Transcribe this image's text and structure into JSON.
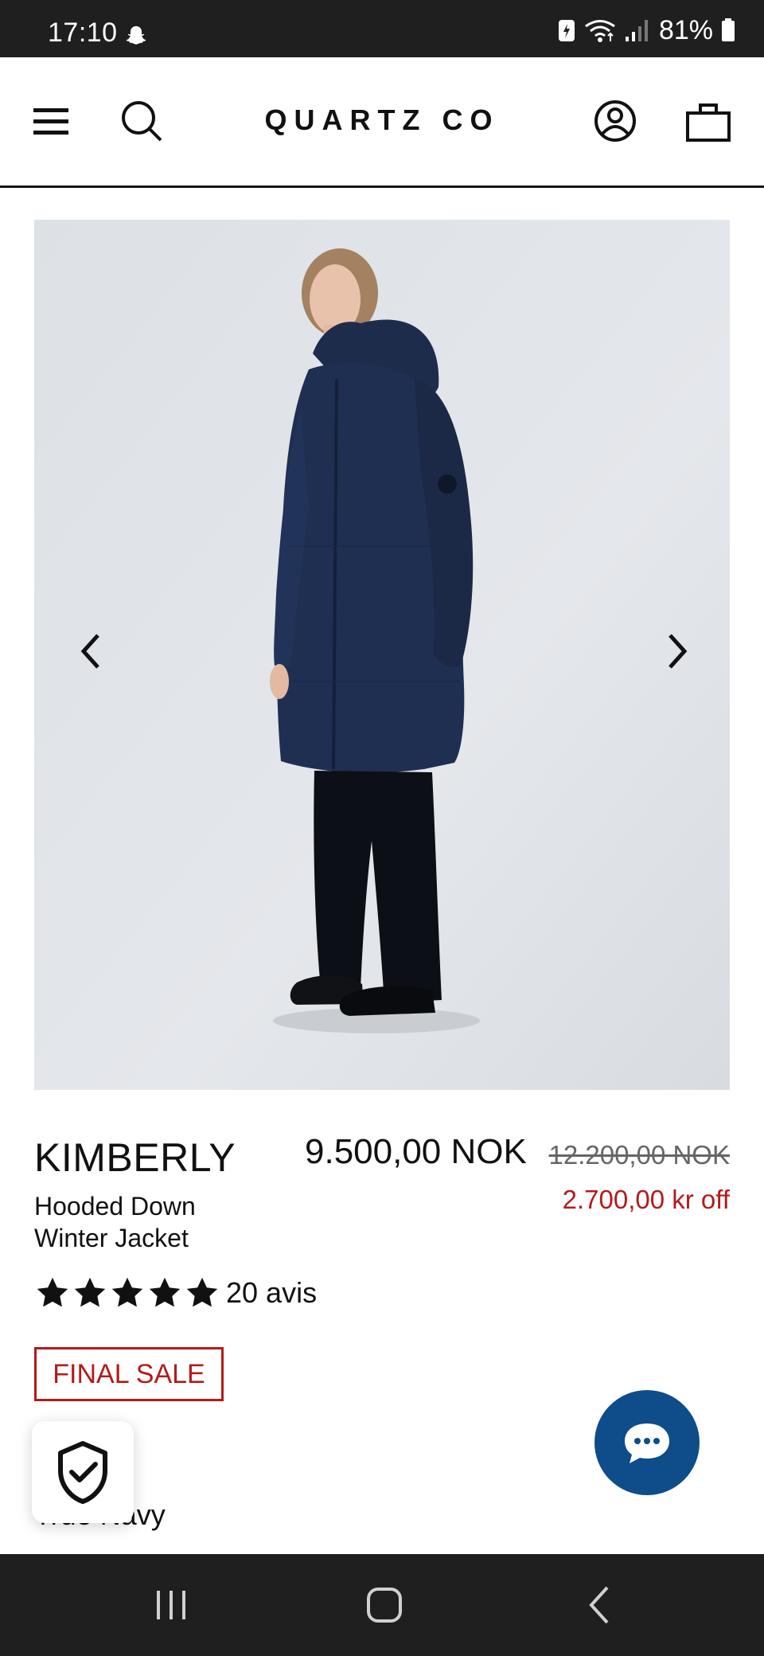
{
  "status_bar": {
    "time": "17:10",
    "battery": "81%",
    "icons": [
      "snapchat-icon",
      "battery-saver-icon",
      "wifi-icon",
      "signal-icon",
      "battery-icon"
    ]
  },
  "header": {
    "logo": "QUARTZ CO",
    "icons": [
      "menu-icon",
      "search-icon",
      "account-icon",
      "bag-icon"
    ]
  },
  "product": {
    "name": "KIMBERLY",
    "subtitle": "Hooded Down Winter Jacket",
    "price": "9.500,00 NOK",
    "original_price": "12.200,00 NOK",
    "discount": "2.700,00 kr off",
    "rating": 5,
    "reviews": "20 avis",
    "badge": "FINAL SALE",
    "color": "True Navy",
    "image_alt": "Model wearing navy hooded down winter jacket"
  },
  "colors": {
    "accent_red": "#b31b1b",
    "chat_blue": "#0f4c8a",
    "jacket_navy": "#1f2f52"
  }
}
